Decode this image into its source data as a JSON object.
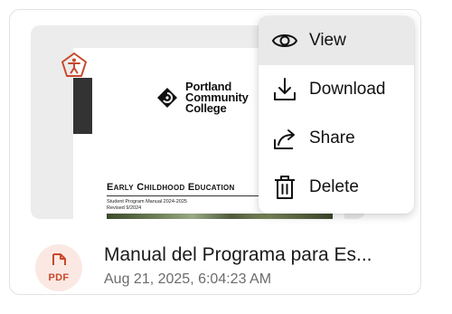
{
  "thumbnail": {
    "org_line1": "Portland",
    "org_line2": "Community",
    "org_line3": "College",
    "doc_heading": "Early Childhood Education",
    "doc_sub1": "Student Program Manual 2024-2025",
    "doc_sub2": "Revised 9/2024"
  },
  "accessibility_icon": "accessibility-pentagon-icon",
  "menu": {
    "items": [
      {
        "label": "View",
        "icon": "eye-icon"
      },
      {
        "label": "Download",
        "icon": "download-icon"
      },
      {
        "label": "Share",
        "icon": "share-icon"
      },
      {
        "label": "Delete",
        "icon": "trash-icon"
      }
    ]
  },
  "file": {
    "type_label": "PDF",
    "name": "Manual del Programa para Es...",
    "date": "Aug 21, 2025, 6:04:23 AM"
  },
  "colors": {
    "accent_red": "#c8492b",
    "badge_bg": "#fbe8e3",
    "active_menu_bg": "#e9e9e9"
  }
}
